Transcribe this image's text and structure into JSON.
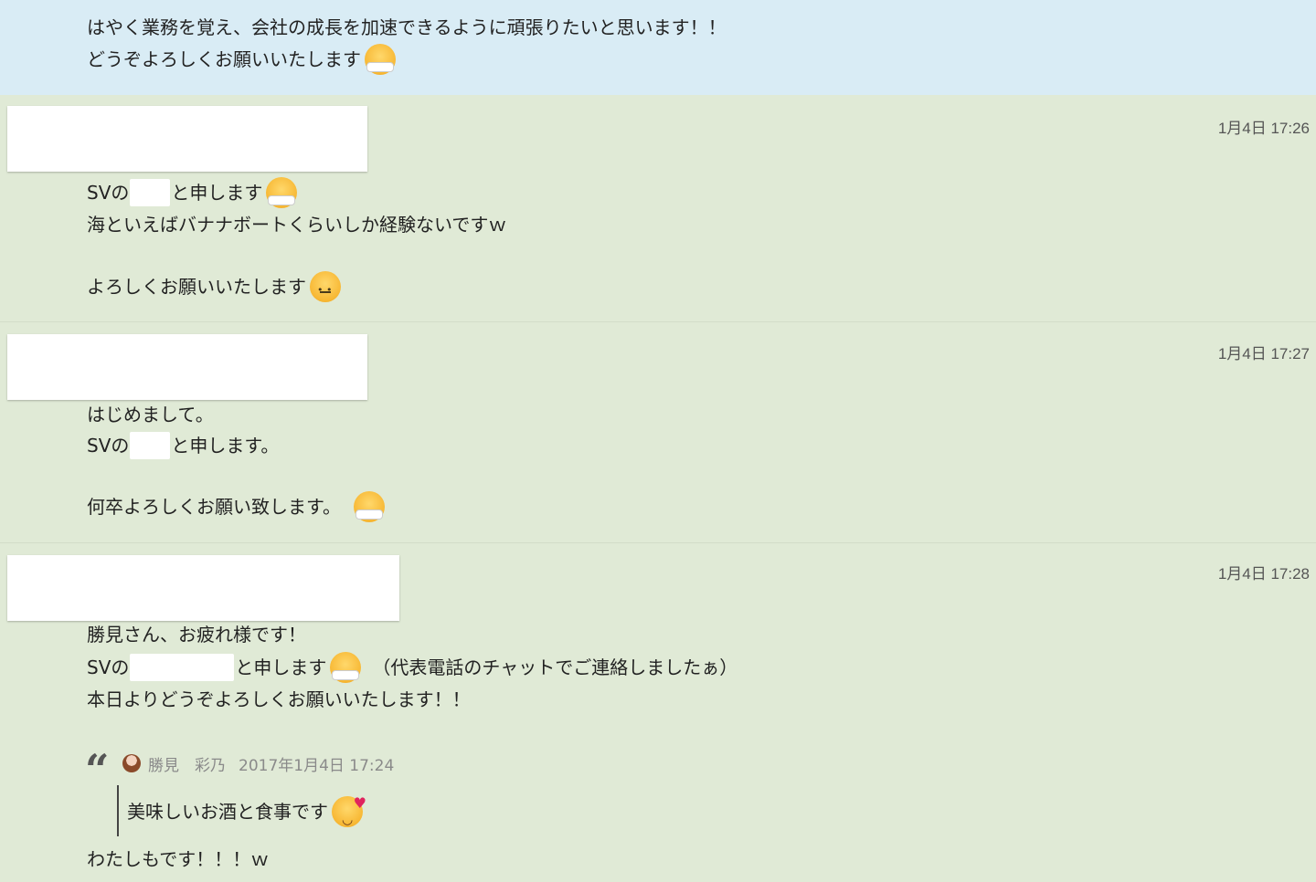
{
  "top_message": {
    "line1": "はやく業務を覚え、会社の成長を加速できるように頑張りたいと思います！！",
    "line2": "どうぞよろしくお願いいたします"
  },
  "messages": [
    {
      "timestamp": "1月4日 17:26",
      "line1_prefix": "SVの",
      "line1_suffix": "と申します",
      "line2": "海といえばバナナボートくらいしか経験ないですｗ",
      "line3": "よろしくお願いいたします"
    },
    {
      "timestamp": "1月4日 17:27",
      "line1": "はじめまして。",
      "line2_prefix": "SVの",
      "line2_suffix": "と申します。",
      "line3": "何卒よろしくお願い致します。"
    },
    {
      "timestamp": "1月4日 17:28",
      "line1": "勝見さん、お疲れ様です！",
      "line2_prefix": "SVの",
      "line2_suffix": "と申します",
      "line2_tail": "（代表電話のチャットでご連絡しましたぁ）",
      "line3": "本日よりどうぞよろしくお願いいたします！！",
      "quote": {
        "author": "勝見　彩乃",
        "date": "2017年1月4日 17:24",
        "text": "美味しいお酒と食事です"
      },
      "reply": "わたしもです！！！ｗ"
    }
  ],
  "icons": {
    "bow": "bowing-face-emoji",
    "neutral": "neutral-face-emoji",
    "love": "smiling-face-with-hearts-emoji",
    "quote": "quote-icon"
  }
}
